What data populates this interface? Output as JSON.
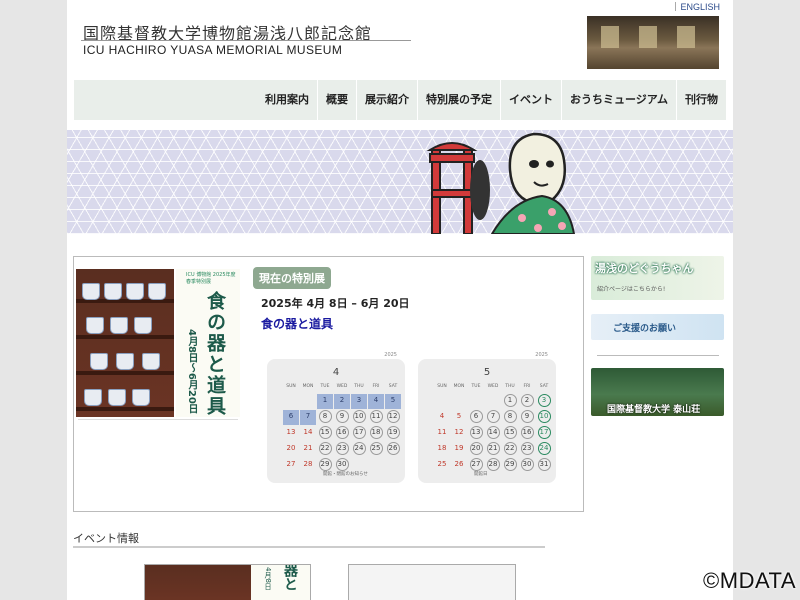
{
  "header": {
    "title_jp": "国際基督教大学博物館湯浅八郎記念館",
    "title_en": "ICU HACHIRO YUASA MEMORIAL MUSEUM",
    "english_link": "ENGLISH"
  },
  "nav": {
    "items": [
      "利用案内",
      "概要",
      "展示紹介",
      "特別展の予定",
      "イベント",
      "おうちミュージアム",
      "刊行物"
    ]
  },
  "exhibition": {
    "badge": "現在の特別展",
    "dates": "2025年 4月 8日 – 6月 20日",
    "title": "食の器と道具",
    "poster_title": "食の器と道具",
    "poster_dates": "4月8日〜6月20日",
    "poster_head": "ICU 博物館 2025年度 春季特別展"
  },
  "calendars": [
    {
      "month": "4",
      "year": "2025",
      "dows": [
        "SUN",
        "MON",
        "TUE",
        "WED",
        "THU",
        "FRI",
        "SAT"
      ],
      "days": [
        "",
        "",
        "1",
        "2",
        "3",
        "4",
        "5",
        "6",
        "7",
        "8",
        "9",
        "10",
        "11",
        "12",
        "13",
        "14",
        "15",
        "16",
        "17",
        "18",
        "19",
        "20",
        "21",
        "22",
        "23",
        "24",
        "25",
        "26",
        "27",
        "28",
        "29",
        "30"
      ],
      "legend": "開館・閉館のお知らせ"
    },
    {
      "month": "5",
      "year": "2025",
      "dows": [
        "SUN",
        "MON",
        "TUE",
        "WED",
        "THU",
        "FRI",
        "SAT"
      ],
      "days": [
        "",
        "",
        "",
        "",
        "1",
        "2",
        "3",
        "4",
        "5",
        "6",
        "7",
        "8",
        "9",
        "10",
        "11",
        "12",
        "13",
        "14",
        "15",
        "16",
        "17",
        "18",
        "19",
        "20",
        "21",
        "22",
        "23",
        "24",
        "25",
        "26",
        "27",
        "28",
        "29",
        "30",
        "31"
      ],
      "legend": "開館日"
    }
  ],
  "sidebar": {
    "character_label": "湯浅のどぐうちゃん",
    "character_sub": "紹介ページはこちらから!",
    "support_label": "ご支援のお願い",
    "house_label": "国際基督教大学 泰山荘"
  },
  "events": {
    "heading": "イベント情報",
    "card1_title": "器と",
    "card1_date": "4月8日"
  },
  "watermark": "©MDATA",
  "colors": {
    "nav_bg": "#e9eeea",
    "badge_bg": "#8ea890",
    "title_link": "#1a1aa0",
    "closed_day": "#9fb3d8"
  }
}
